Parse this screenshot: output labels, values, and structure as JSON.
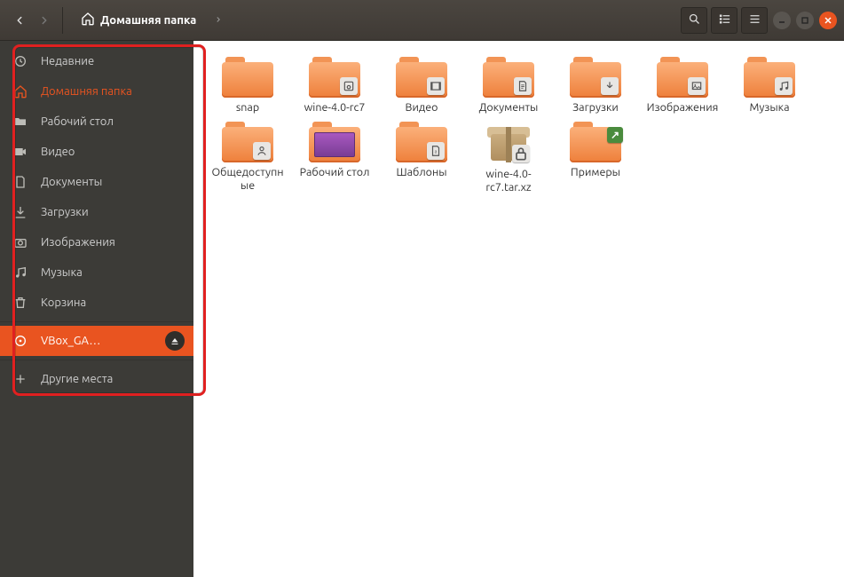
{
  "header": {
    "path_label": "Домашняя папка"
  },
  "sidebar": {
    "items": [
      {
        "label": "Недавние"
      },
      {
        "label": "Домашняя папка"
      },
      {
        "label": "Рабочий стол"
      },
      {
        "label": "Видео"
      },
      {
        "label": "Документы"
      },
      {
        "label": "Загрузки"
      },
      {
        "label": "Изображения"
      },
      {
        "label": "Музыка"
      },
      {
        "label": "Корзина"
      },
      {
        "label": "VBox_GA…"
      },
      {
        "label": "Другие места"
      }
    ]
  },
  "files": [
    {
      "label": "snap",
      "kind": "folder"
    },
    {
      "label": "wine-4.0-rc7",
      "kind": "folder-disk"
    },
    {
      "label": "Видео",
      "kind": "folder-video"
    },
    {
      "label": "Документы",
      "kind": "folder-docs"
    },
    {
      "label": "Загрузки",
      "kind": "folder-downloads"
    },
    {
      "label": "Изображения",
      "kind": "folder-pictures"
    },
    {
      "label": "Музыка",
      "kind": "folder-music"
    },
    {
      "label": "Общедоступные",
      "kind": "folder-public"
    },
    {
      "label": "Рабочий стол",
      "kind": "folder-desktop"
    },
    {
      "label": "Шаблоны",
      "kind": "folder-templates"
    },
    {
      "label": "wine-4.0-rc7.tar.xz",
      "kind": "archive"
    },
    {
      "label": "Примеры",
      "kind": "folder-link"
    }
  ]
}
